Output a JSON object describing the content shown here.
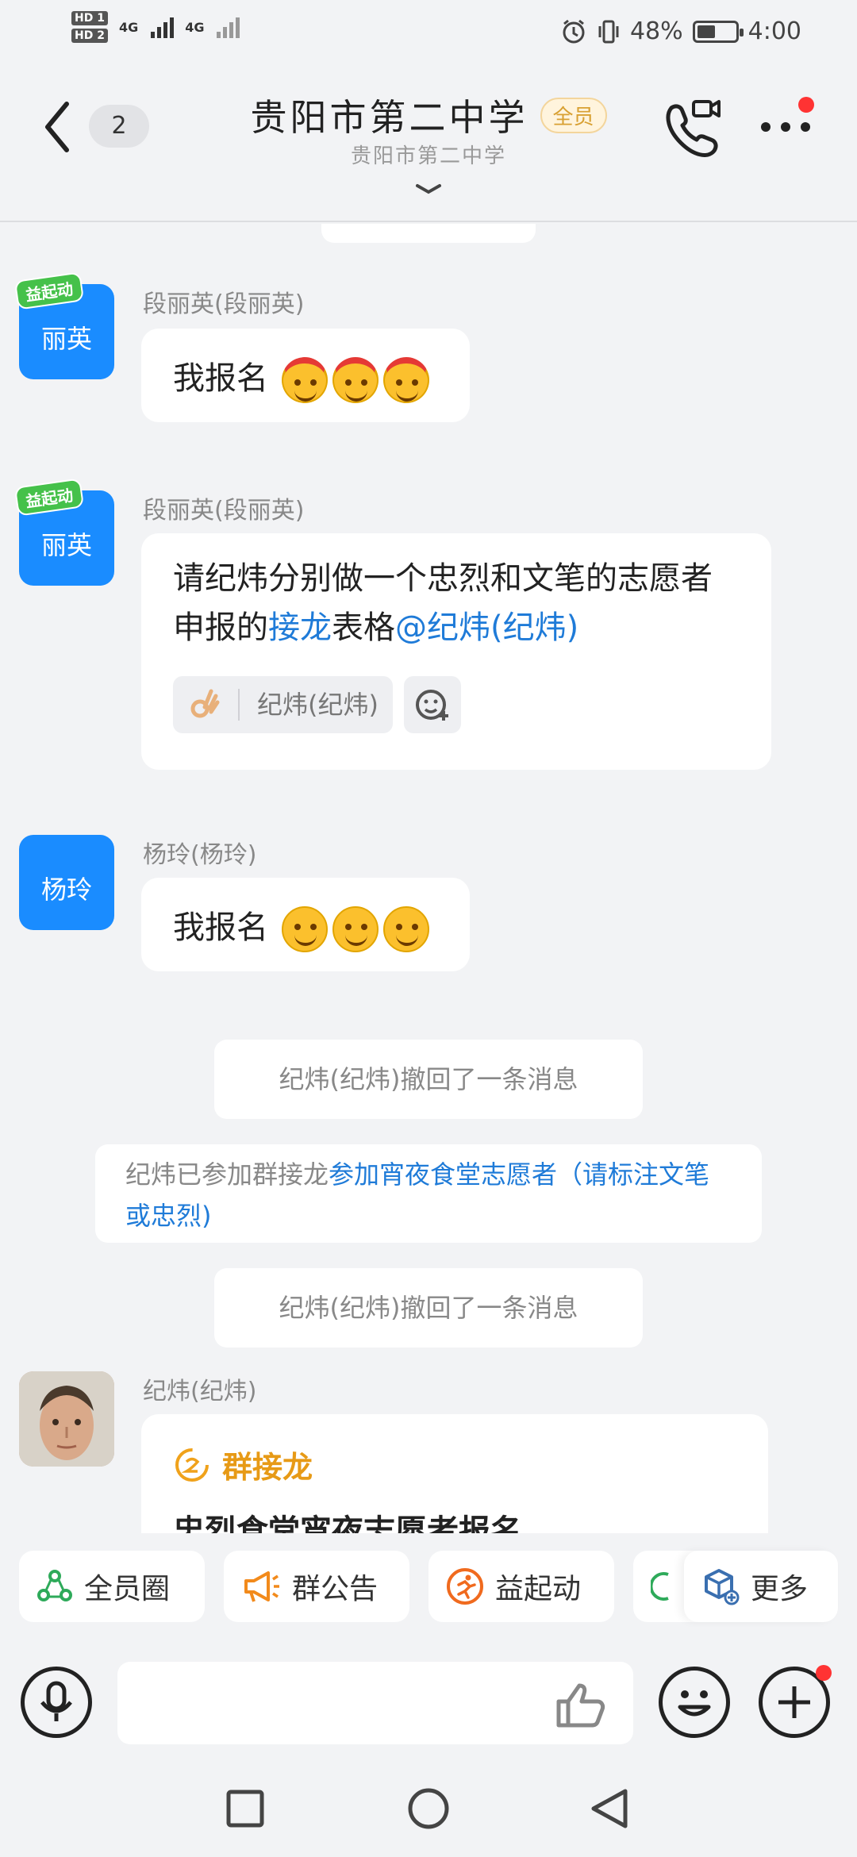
{
  "status_bar": {
    "hd1": "HD 1",
    "hd2": "HD 2",
    "net1": "4G",
    "net2": "4G",
    "battery": "48%",
    "time": "4:00"
  },
  "header": {
    "unread_count": "2",
    "title": "贵阳市第二中学",
    "badge": "全员",
    "subtitle": "贵阳市第二中学"
  },
  "messages": [
    {
      "sender": "段丽英(段丽英)",
      "avatar_text": "丽英",
      "avatar_badge": "益起动",
      "text": "我报名"
    },
    {
      "sender": "段丽英(段丽英)",
      "avatar_text": "丽英",
      "avatar_badge": "益起动",
      "text_part1": "请纪炜分别做一个忠烈和文笔的志愿者申报的",
      "link1": "接龙",
      "text_part2": "表格",
      "mention": "@纪炜(纪炜)",
      "reaction_user": "纪炜(纪炜)"
    },
    {
      "sender": "杨玲(杨玲)",
      "avatar_text": "杨玲",
      "text": "我报名"
    },
    {
      "sender": "纪炜(纪炜)",
      "card_title": "群接龙",
      "card_text": "忠烈食堂宵夜志愿者报名"
    }
  ],
  "system": {
    "recall1": "纪炜(纪炜)撤回了一条消息",
    "join_prefix": "纪炜已参加群接龙",
    "join_link": "参加宵夜食堂志愿者（请标注文笔或忠烈)",
    "recall2": "纪炜(纪炜)撤回了一条消息"
  },
  "shortcuts": [
    {
      "label": "全员圈",
      "icon": "circle-group-icon",
      "color": "#2eaa5a"
    },
    {
      "label": "群公告",
      "icon": "megaphone-icon",
      "color": "#f28a1b"
    },
    {
      "label": "益起动",
      "icon": "running-icon",
      "color": "#f06a1e"
    },
    {
      "label": "更多",
      "icon": "cube-plus-icon",
      "color": "#3a6fb0"
    }
  ],
  "input": {
    "placeholder": ""
  }
}
